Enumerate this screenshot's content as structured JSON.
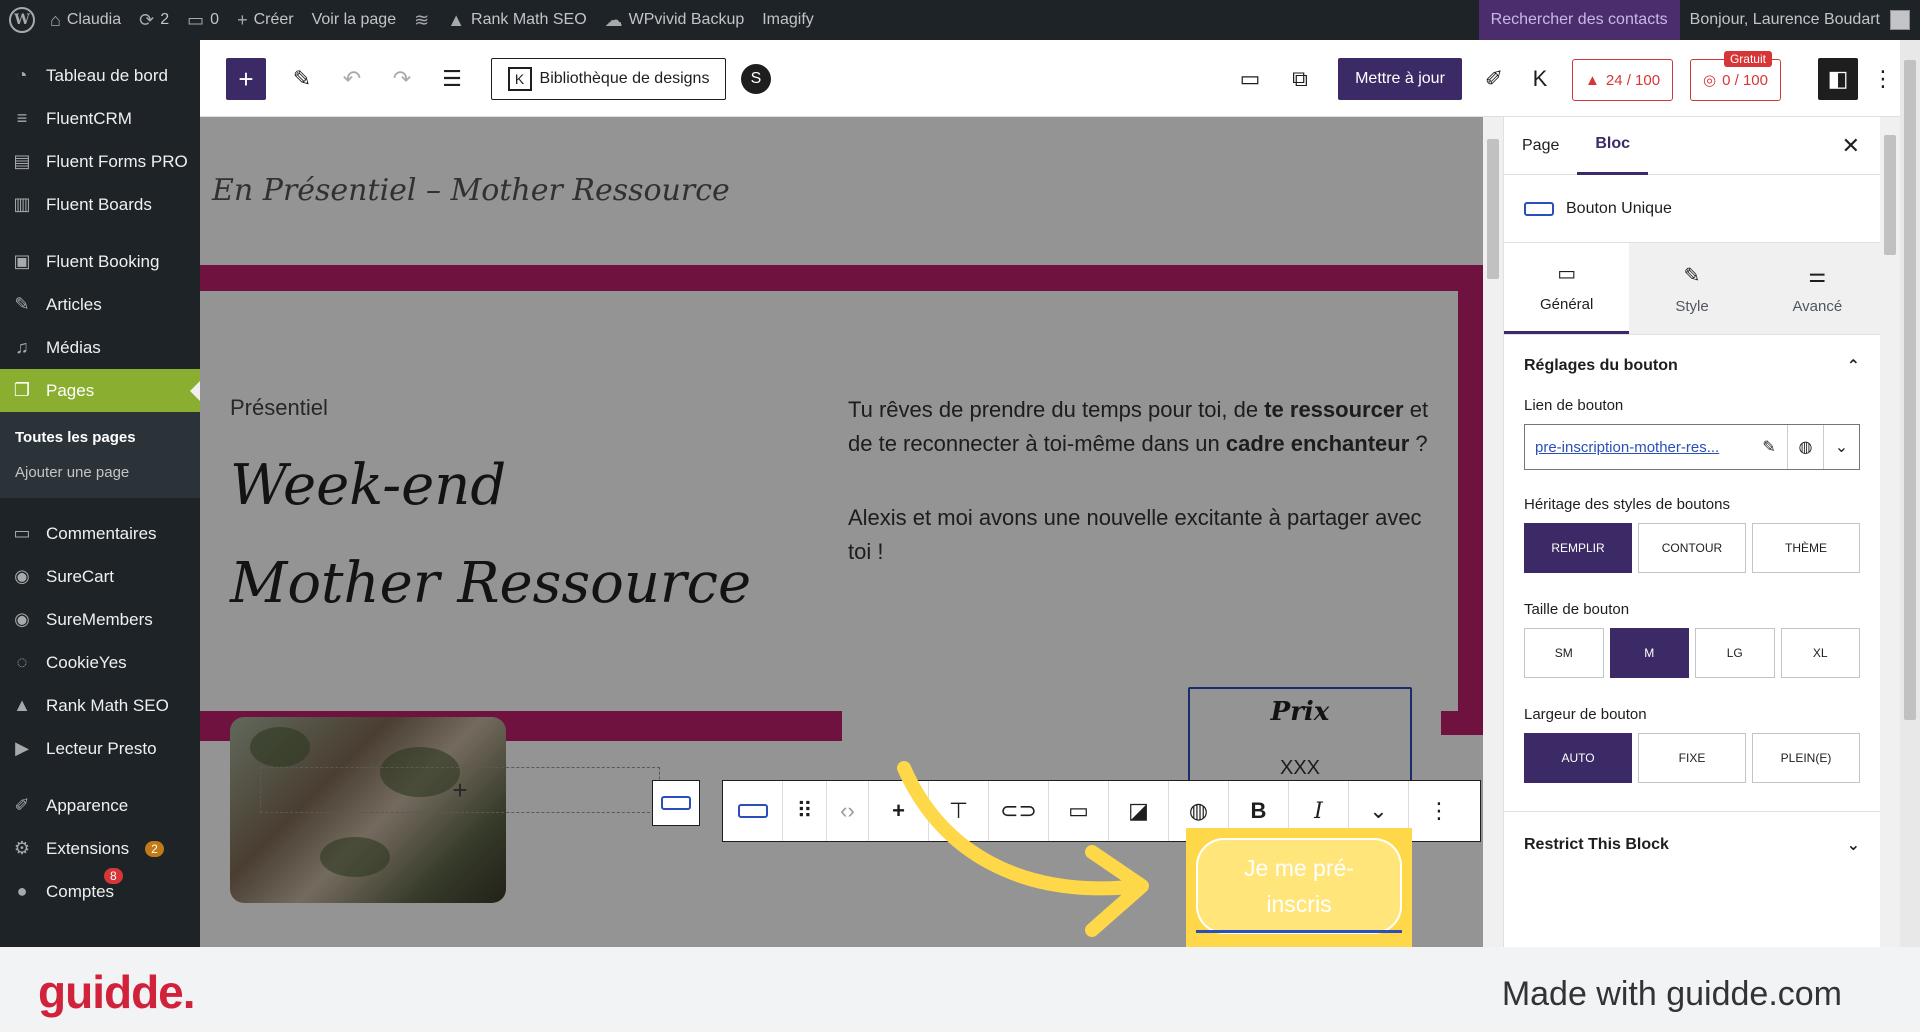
{
  "adminbar": {
    "site_name": "Claudia",
    "updates_count": "2",
    "comments_count": "0",
    "create_label": "Créer",
    "view_page_label": "Voir la page",
    "rankmath_label": "Rank Math SEO",
    "wpvivid_label": "WPvivid Backup",
    "imagify_label": "Imagify",
    "contacts_label": "Rechercher des contacts",
    "greeting": "Bonjour, Laurence Boudart"
  },
  "sidebar": {
    "items": [
      {
        "label": "Tableau de bord",
        "icon": "dashboard-icon"
      },
      {
        "label": "FluentCRM",
        "icon": "fluentcrm-icon"
      },
      {
        "label": "Fluent Forms PRO",
        "icon": "forms-icon"
      },
      {
        "label": "Fluent Boards",
        "icon": "boards-icon"
      },
      {
        "label": "Fluent Booking",
        "icon": "booking-icon"
      },
      {
        "label": "Articles",
        "icon": "pin-icon"
      },
      {
        "label": "Médias",
        "icon": "media-icon"
      },
      {
        "label": "Pages",
        "icon": "pages-icon"
      }
    ],
    "submenu": [
      "Toutes les pages",
      "Ajouter une page"
    ],
    "items2": [
      {
        "label": "Commentaires",
        "icon": "comment-icon"
      },
      {
        "label": "SureCart",
        "icon": "surecart-icon"
      },
      {
        "label": "SureMembers",
        "icon": "suremembers-icon"
      },
      {
        "label": "CookieYes",
        "icon": "cookie-icon"
      },
      {
        "label": "Rank Math SEO",
        "icon": "rankmath-icon"
      },
      {
        "label": "Lecteur Presto",
        "icon": "presto-icon"
      },
      {
        "label": "Apparence",
        "icon": "appearance-icon"
      },
      {
        "label": "Extensions",
        "icon": "plugin-icon",
        "badge": "2"
      },
      {
        "label": "Comptes",
        "icon": "user-icon"
      }
    ],
    "notif_count": "8"
  },
  "toolbar": {
    "library_label": "Bibliothèque de designs",
    "update_label": "Mettre à jour",
    "seo_score": "24 / 100",
    "readability_score": "0 / 100",
    "free_badge": "Gratuit"
  },
  "canvas": {
    "site_title": "En Présentiel – Mother Ressource",
    "kicker": "Présentiel",
    "title_line1": "Week-end",
    "title_line2": "Mother Ressource",
    "para1_a": "Tu rêves de prendre du temps pour toi, de ",
    "para1_b": "te ressourcer",
    "para1_c": " et de te reconnecter à toi-même dans un ",
    "para1_d": "cadre enchanteur",
    "para1_e": " ?",
    "para2": "Alexis et moi avons une nouvelle excitante à partager avec toi !",
    "price_title": "Prix",
    "price_value": "XXX",
    "cta_label": "Je me pré-inscris"
  },
  "panel": {
    "tab_page": "Page",
    "tab_block": "Bloc",
    "block_name": "Bouton Unique",
    "subtab_general": "Général",
    "subtab_style": "Style",
    "subtab_advanced": "Avancé",
    "section_title": "Réglages du bouton",
    "link_label": "Lien de bouton",
    "link_value": "pre-inscription-mother-res...",
    "inherit_label": "Héritage des styles de boutons",
    "inherit_options": [
      "REMPLIR",
      "CONTOUR",
      "THÈME"
    ],
    "size_label": "Taille de bouton",
    "size_options": [
      "SM",
      "M",
      "LG",
      "XL"
    ],
    "width_label": "Largeur de bouton",
    "width_options": [
      "AUTO",
      "FIXE",
      "PLEIN(E)"
    ],
    "restrict_label": "Restrict This Block"
  },
  "footer": {
    "brand": "guidde.",
    "made_with": "Made with guidde.com"
  },
  "colors": {
    "brand_purple": "#3c2a66",
    "accent_pink": "#c2206d",
    "highlight_yellow": "#ffd84a",
    "guidde_red": "#d1223b"
  }
}
